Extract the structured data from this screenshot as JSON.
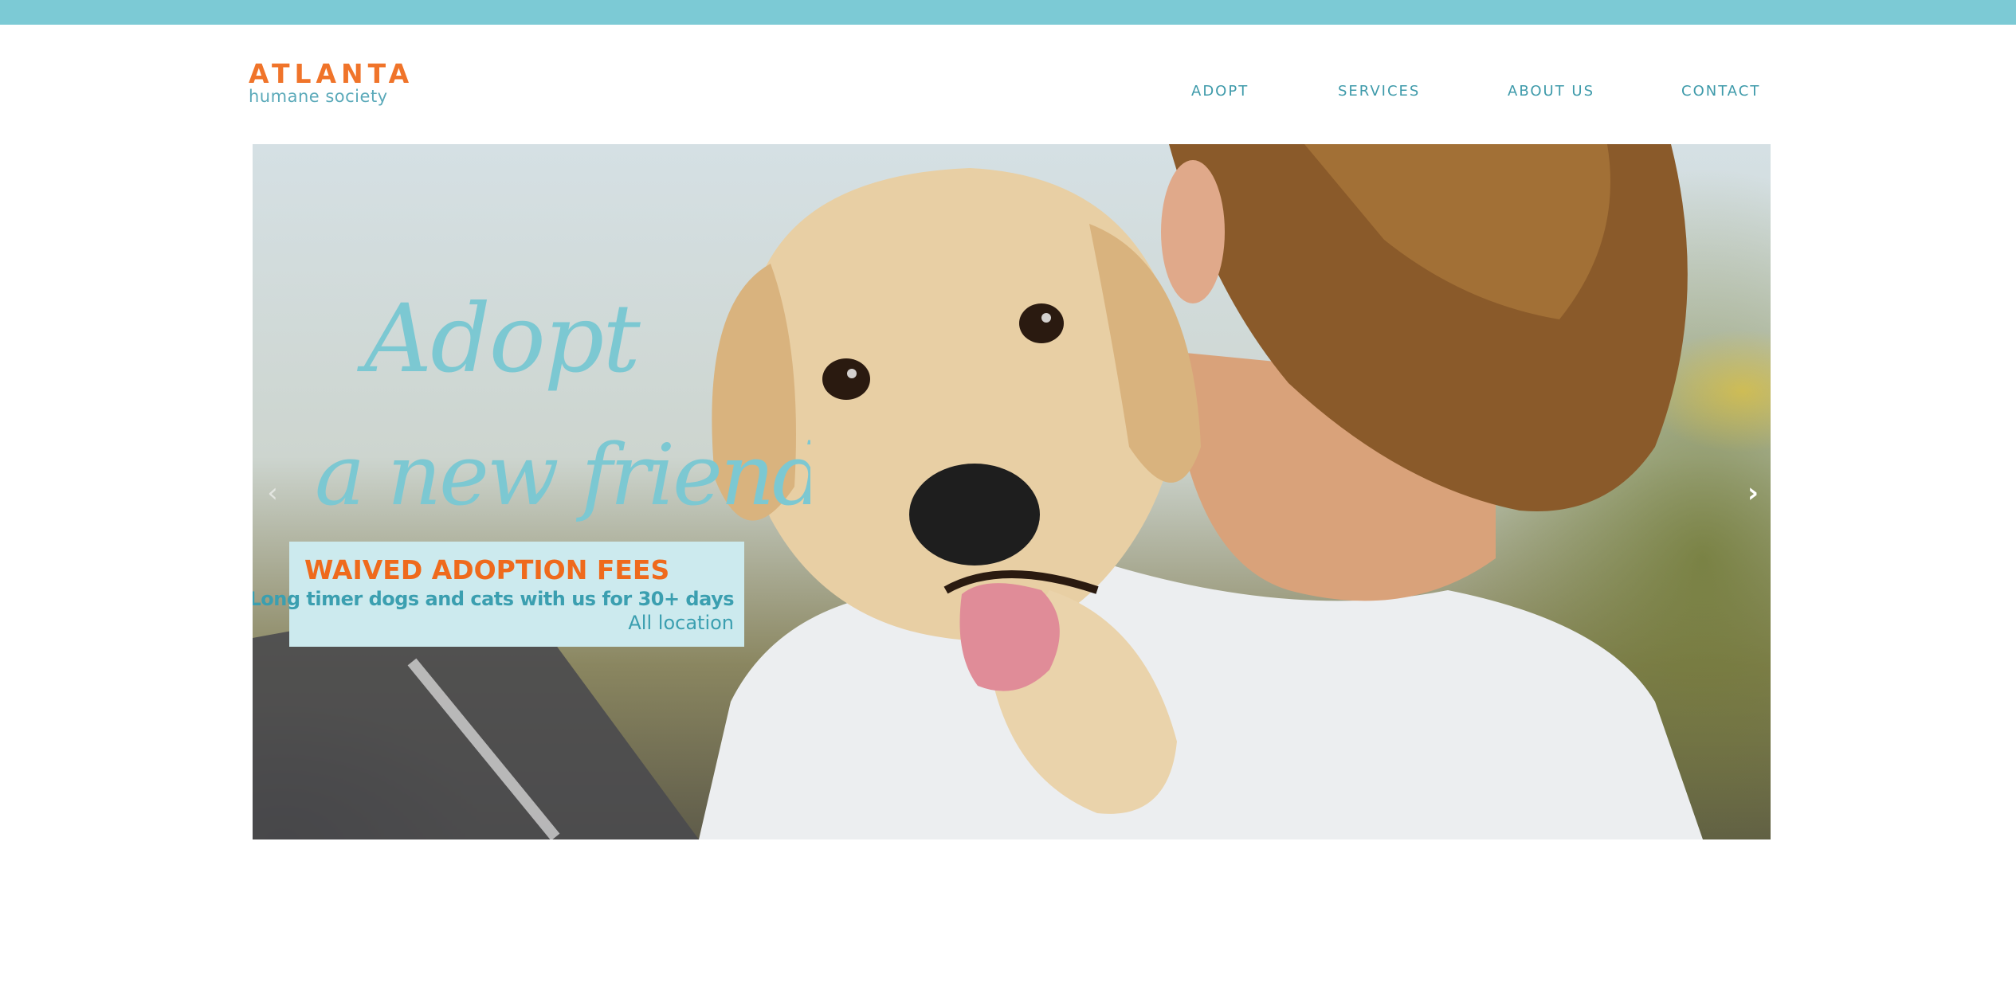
{
  "brand": {
    "title": "ATLANTA",
    "subtitle": "humane society",
    "primary_color": "#f0742a",
    "accent_color": "#7ccad5"
  },
  "nav": {
    "items": [
      {
        "label": "ADOPT"
      },
      {
        "label": "SERVICES"
      },
      {
        "label": "ABOUT US"
      },
      {
        "label": "CONTACT"
      }
    ]
  },
  "hero": {
    "headline_line1": "Adopt",
    "headline_line2": "a new friend",
    "promo_title": "WAIVED ADOPTION FEES",
    "promo_text": "Long timer dogs and cats with us for 30+ days",
    "promo_location": "All location",
    "prev_icon": "‹",
    "next_icon": "›",
    "image": "puppy-on-shoulder-photo"
  }
}
